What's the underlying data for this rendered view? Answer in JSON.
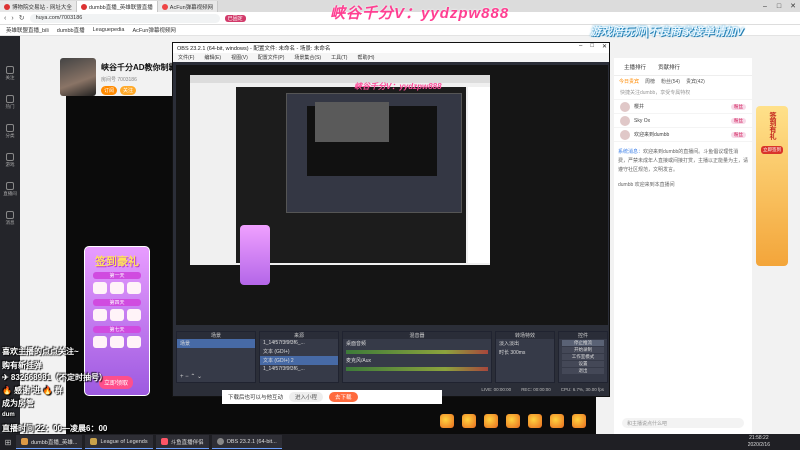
{
  "browser": {
    "tabs": [
      {
        "label": "博物院交易站 - 网址大全"
      },
      {
        "label": "dumbb直播_英雄联盟直播"
      },
      {
        "label": "AcFun弹幕视频网"
      }
    ],
    "url": "huya.com/7003186",
    "bookmarks": [
      "英雄联盟直播_bili",
      "dumbb直播",
      "Leaguepedia",
      "AcFun弹幕视频网"
    ],
    "pin_text": "已固定"
  },
  "watermark": "峡谷千分V：yydzpw888",
  "banner": "游戏陪玩师|不良商家接单请加V",
  "streamer": {
    "name": "峡谷千分AD教你制霸",
    "id": "房间号 7003186",
    "badge1": "订阅",
    "badge2": "关注"
  },
  "leftnav": [
    "关注",
    "热门",
    "分类",
    "游戏",
    "直播间",
    "消息"
  ],
  "obs": {
    "title": "OBS 23.2.1 (64-bit, windows) - 配置文件: 未命名 - 场景: 未命名",
    "menu": [
      "文件(F)",
      "编辑(E)",
      "视图(V)",
      "配置文件(P)",
      "场景集合(S)",
      "工具(T)",
      "帮助(H)"
    ],
    "docks": {
      "scenes": {
        "header": "场景",
        "items": [
          "场景"
        ]
      },
      "sources": {
        "header": "来源",
        "items": [
          "1_14f57f3f9f3f6_...",
          "文本 (GDI+)",
          "文本 (GDI+) 2",
          "1_14f57f3f9f3f6_..."
        ]
      },
      "mixer": {
        "header": "混音器",
        "items": [
          "桌面音频",
          "麦克风/Aux"
        ]
      },
      "transitions": {
        "header": "转场特效",
        "items": [
          "淡入淡出",
          "时长 300ms"
        ]
      },
      "controls": {
        "header": "控件",
        "items": [
          "停止推流",
          "开始录制",
          "工作室模式",
          "设置",
          "退出"
        ]
      }
    },
    "status": [
      "LIVE: 00:00:00",
      "REC: 00:00:00",
      "CPU: 6.7%, 30.00 fps"
    ]
  },
  "notification": {
    "text": "下载后也可以与他互动",
    "cancel": "进入小程",
    "open": "去下载"
  },
  "chat": {
    "top_tabs": [
      "主播排行",
      "贡献排行"
    ],
    "tabs": [
      "今日贵宾",
      "周榜",
      "粉丝(54)",
      "贵宾(42)"
    ],
    "notice": "快捷关注dumbb，享受专属特权",
    "users": [
      {
        "name": "樱井",
        "tag": "粉丝"
      },
      {
        "name": "Sky Ox",
        "tag": "粉丝"
      },
      {
        "name": "欢迎来到dumbb",
        "tag": "粉丝"
      }
    ],
    "system_prefix": "系统消息：",
    "system_text": "欢迎来到dumbb的直播间。斗鱼倡议理性消费，严禁未成年人直接或间接打赏，主播以正能量为主，请遵守社区规范，文明发言。",
    "welcome": "dumbb 欢迎来到本直播间",
    "input_placeholder": "和主播说点什么吧"
  },
  "promo": {
    "title": "签到有礼",
    "button": "立即签到"
  },
  "signin": {
    "title": "签到豪礼",
    "day1": "第一天",
    "day4": "第四天",
    "day7": "第七天",
    "button": "立即领取"
  },
  "overlay_chat": [
    "喜欢主播的点点关注~",
    "购有新挂弹",
    "✈ 832668981（不定时抽号）",
    "🔥 感谢 进 🔥 群",
    "成为房管",
    "dum",
    "直播时间 22：00—凌晨6：00"
  ],
  "taskbar": {
    "items": [
      "dumbb直播_英雄...",
      "League of Legends",
      "斗鱼直播伴侣",
      "OBS 23.2.1 (64-bit..."
    ],
    "time": "21:58:22",
    "date": "2020/2/16"
  }
}
